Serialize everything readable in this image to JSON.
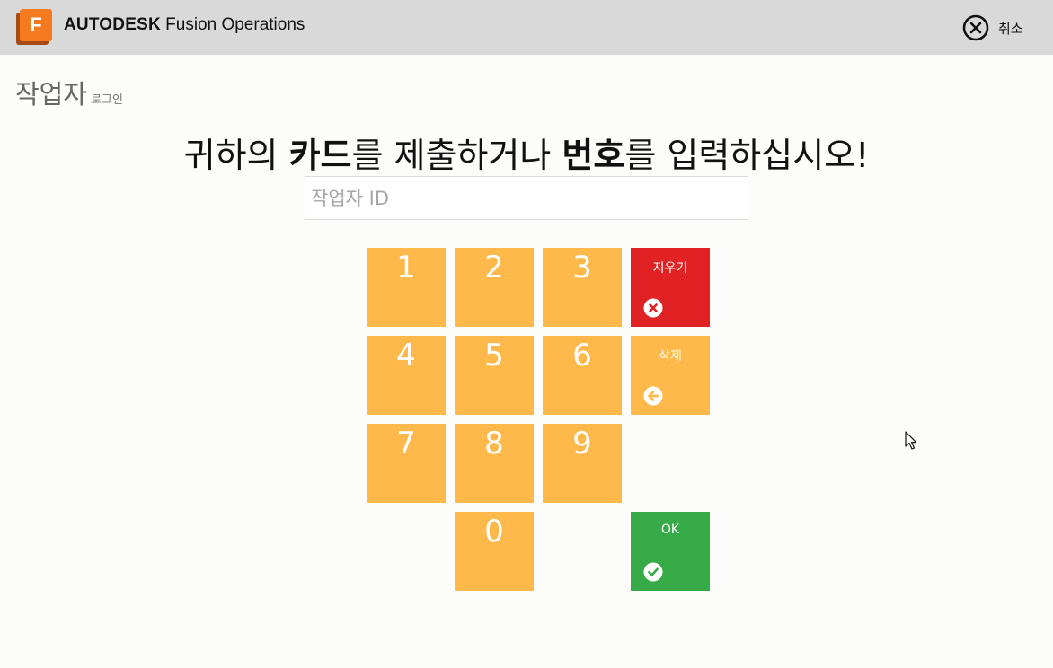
{
  "header": {
    "brand_bold": "AUTODESK",
    "brand_rest": " Fusion Operations",
    "logo_letter": "F",
    "cancel_label": "취소",
    "cancel_icon": "close-circle-icon"
  },
  "page": {
    "title": "작업자",
    "subtitle": "로그인"
  },
  "instruction": {
    "part1": "귀하의 ",
    "card": "카드",
    "part2": "를 제출하거나 ",
    "number": "번호",
    "part3": "를 입력하십시오!"
  },
  "id_field": {
    "placeholder": "작업자 ID",
    "value": ""
  },
  "keypad": {
    "digits": [
      "1",
      "2",
      "3",
      "4",
      "5",
      "6",
      "7",
      "8",
      "9",
      "0"
    ],
    "clear_label": "지우기",
    "clear_icon": "clear-x-icon",
    "delete_label": "삭제",
    "delete_icon": "backspace-arrow-icon",
    "ok_label": "OK",
    "ok_icon": "check-icon"
  },
  "colors": {
    "header_bg": "#d9d9d9",
    "key_orange": "#ffb84a",
    "key_red": "#e02224",
    "key_green": "#37aa48",
    "brand_orange": "#f57a20"
  }
}
